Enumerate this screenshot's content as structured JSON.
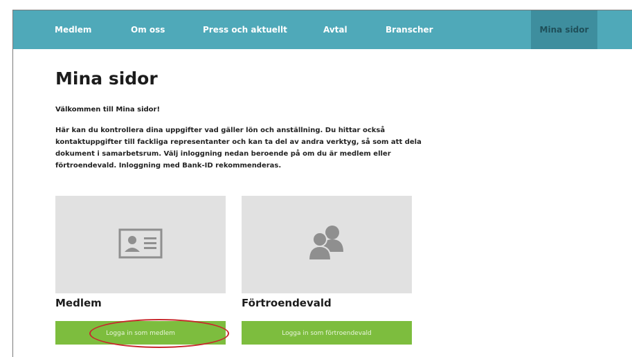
{
  "nav": {
    "items": [
      {
        "label": "Medlem"
      },
      {
        "label": "Om oss"
      },
      {
        "label": "Press och aktuellt"
      },
      {
        "label": "Avtal"
      },
      {
        "label": "Branscher"
      },
      {
        "label": "Mina sidor",
        "active": true
      }
    ]
  },
  "main": {
    "title": "Mina sidor",
    "welcome": "Välkommen till Mina sidor!",
    "intro": "Här kan du kontrollera dina uppgifter vad gäller lön och anställning. Du hittar också kontaktuppgifter till fackliga representanter och kan ta del av andra verktyg, så som att dela dokument i samarbetsrum. Välj inloggning nedan beroende på om du är medlem eller förtroendevald. Inloggning med Bank-ID rekommenderas."
  },
  "cards": [
    {
      "title": "Medlem",
      "button_label": "Logga in som medlem",
      "icon": "id-card-icon"
    },
    {
      "title": "Förtroendevald",
      "button_label": "Logga in som förtroendevald",
      "icon": "users-icon"
    }
  ],
  "colors": {
    "nav_bg": "#4fa9b9",
    "nav_active_bg": "#3e8e9e",
    "button_green": "#7dbd3e",
    "card_bg": "#e1e1e1",
    "highlight_red": "#c8282d"
  }
}
